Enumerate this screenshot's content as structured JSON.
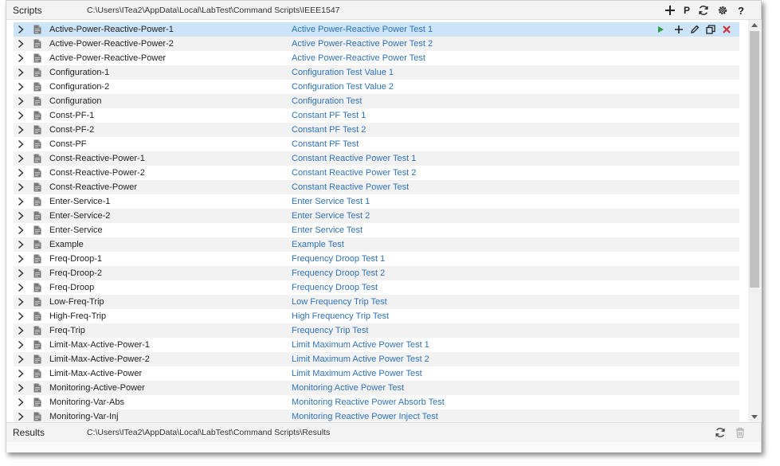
{
  "header": {
    "title": "Scripts",
    "path": "C:\\Users\\ITea2\\AppData\\Local\\LabTest\\Command Scripts\\IEEE1547",
    "p_label": "P",
    "help_label": "?"
  },
  "colors": {
    "selected_row": "#cce4f7",
    "link_text": "#2f73b7",
    "run_icon": "#2e9d48",
    "delete_icon": "#d4292c"
  },
  "scripts": [
    {
      "name": "Active-Power-Reactive-Power-1",
      "description": "Active Power-Reactive Power Test 1"
    },
    {
      "name": "Active-Power-Reactive-Power-2",
      "description": "Active Power-Reactive Power Test 2"
    },
    {
      "name": "Active-Power-Reactive-Power",
      "description": "Active Power-Reactive Power Test"
    },
    {
      "name": "Configuration-1",
      "description": "Configuration Test Value 1"
    },
    {
      "name": "Configuration-2",
      "description": "Configuration Test Value 2"
    },
    {
      "name": "Configuration",
      "description": "Configuration Test"
    },
    {
      "name": "Const-PF-1",
      "description": "Constant PF Test 1"
    },
    {
      "name": "Const-PF-2",
      "description": "Constant PF Test 2"
    },
    {
      "name": "Const-PF",
      "description": "Constant PF Test"
    },
    {
      "name": "Const-Reactive-Power-1",
      "description": "Constant Reactive Power Test 1"
    },
    {
      "name": "Const-Reactive-Power-2",
      "description": "Constant Reactive Power Test 2"
    },
    {
      "name": "Const-Reactive-Power",
      "description": "Constant Reactive Power Test"
    },
    {
      "name": "Enter-Service-1",
      "description": "Enter Service Test 1"
    },
    {
      "name": "Enter-Service-2",
      "description": "Enter Service Test 2"
    },
    {
      "name": "Enter-Service",
      "description": "Enter Service Test"
    },
    {
      "name": "Example",
      "description": "Example Test"
    },
    {
      "name": "Freq-Droop-1",
      "description": "Frequency Droop Test 1"
    },
    {
      "name": "Freq-Droop-2",
      "description": "Frequency Droop Test 2"
    },
    {
      "name": "Freq-Droop",
      "description": "Frequency Droop Test"
    },
    {
      "name": "Low-Freq-Trip",
      "description": "Low Frequency Trip Test"
    },
    {
      "name": "High-Freq-Trip",
      "description": "High Frequency Trip Test"
    },
    {
      "name": "Freq-Trip",
      "description": "Frequency Trip Test"
    },
    {
      "name": "Limit-Max-Active-Power-1",
      "description": "Limit Maximum Active Power Test 1"
    },
    {
      "name": "Limit-Max-Active-Power-2",
      "description": "Limit Maximum Active Power Test 2"
    },
    {
      "name": "Limit-Max-Active-Power",
      "description": "Limit Maximum Active Power Test"
    },
    {
      "name": "Monitoring-Active-Power",
      "description": "Monitoring Active Power Test"
    },
    {
      "name": "Monitoring-Var-Abs",
      "description": "Monitoring Reactive Power Absorb Test"
    },
    {
      "name": "Monitoring-Var-Inj",
      "description": "Monitoring Reactive Power Inject Test"
    }
  ],
  "selected_index": 0,
  "footer": {
    "title": "Results",
    "path": "C:\\Users\\ITea2\\AppData\\Local\\LabTest\\Command Scripts\\Results"
  }
}
